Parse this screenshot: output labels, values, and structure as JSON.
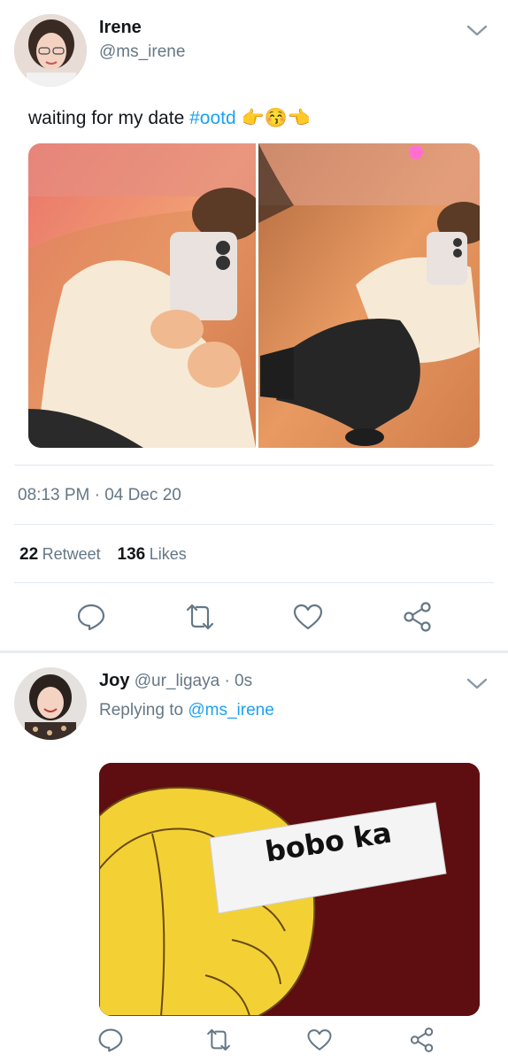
{
  "tweet": {
    "author_name": "Irene",
    "author_handle": "@ms_irene",
    "text_prefix": "waiting for my date ",
    "hashtag": "#ootd",
    "emoji_text": "👉😚👈",
    "timestamp": "08:13 PM · 04 Dec 20",
    "retweet_count": "22",
    "retweet_label": "Retweet",
    "likes_count": "136",
    "likes_label": "Likes",
    "actions": [
      "reply-icon",
      "retweet-icon",
      "like-icon",
      "share-icon"
    ]
  },
  "reply": {
    "author_name": "Joy",
    "author_handle": "@ur_ligaya",
    "time": "· 0s",
    "replying_prefix": "Replying to ",
    "replying_handle": "@ms_irene",
    "image_text": "bobo ka",
    "actions": [
      "reply-icon",
      "retweet-icon",
      "like-icon",
      "share-icon"
    ]
  },
  "colors": {
    "link": "#1da1f2",
    "secondary_text": "#657786",
    "divider": "#e1e8ed",
    "icon": "#657786"
  }
}
